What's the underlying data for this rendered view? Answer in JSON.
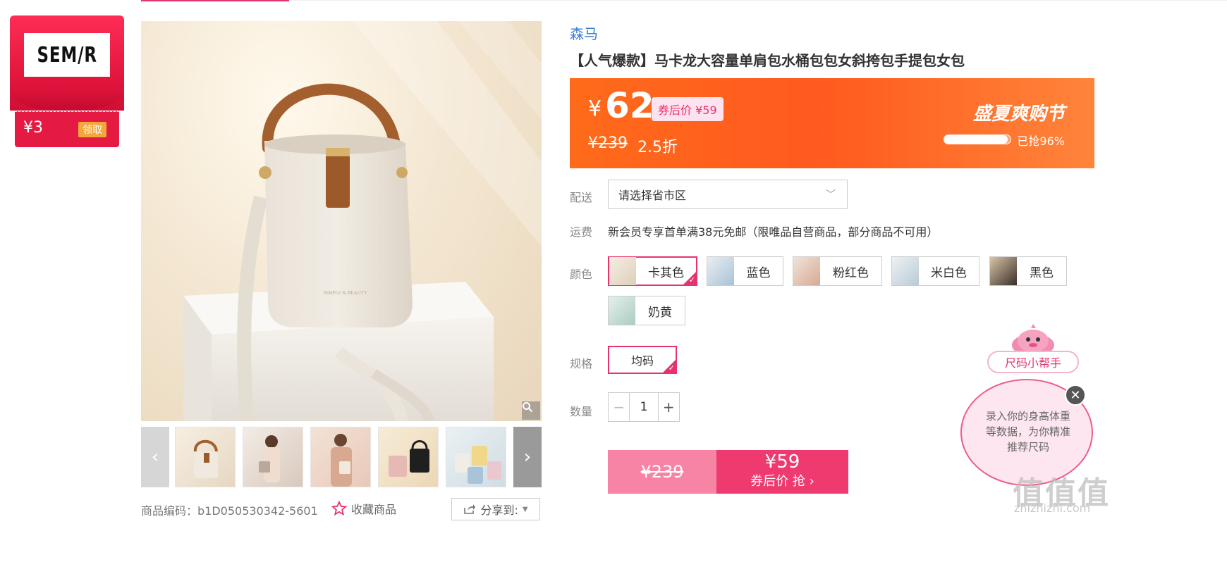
{
  "brand_card": {
    "logo_text": "SEM/R",
    "coupon_amount": "¥3",
    "claim_label": "领取"
  },
  "gallery": {
    "zoom_icon": "search-icon",
    "prev_icon": "‹",
    "next_icon": "›"
  },
  "meta": {
    "product_code": "商品编码：b1D050530342-5601",
    "favorite_label": "收藏商品",
    "share_label": "分享到:"
  },
  "product": {
    "brand": "森马",
    "title": "【人气爆款】马卡龙大容量单肩包水桶包包女斜挎包手提包女包"
  },
  "price": {
    "yen": "¥",
    "current": "62",
    "coupon_price": "券后价 ¥59",
    "original": "¥239",
    "discount": "2.5折",
    "promo_name": "盛夏爽购节",
    "sold_fraction": 0.96,
    "sold_text": "已抢96%"
  },
  "shipping": {
    "label": "配送",
    "select_value": "请选择省市区"
  },
  "freight": {
    "label": "运费",
    "text": "新会员专享首单满38元免邮（限唯品自营商品，部分商品不可用）"
  },
  "colors": {
    "label": "颜色",
    "options": [
      "卡其色",
      "蓝色",
      "粉红色",
      "米白色",
      "黑色",
      "奶黄"
    ],
    "selected": "卡其色"
  },
  "size": {
    "label": "规格",
    "option": "均码"
  },
  "quantity": {
    "label": "数量",
    "minus": "−",
    "value": "1",
    "plus": "+"
  },
  "buy": {
    "original": "¥239",
    "price": "¥59",
    "label": "券后价 抢 ›"
  },
  "helper": {
    "tag": "尺码小帮手",
    "text": "录入你的身高体重等数据，为你精准推荐尺码",
    "close": "✕"
  },
  "watermark": {
    "main": "值值值",
    "sub": "zhizhizhi.com"
  },
  "colors_theme": {
    "accent": "#e6326e",
    "banner": "#ff5a1f",
    "brand_link": "#3a7bd5"
  }
}
